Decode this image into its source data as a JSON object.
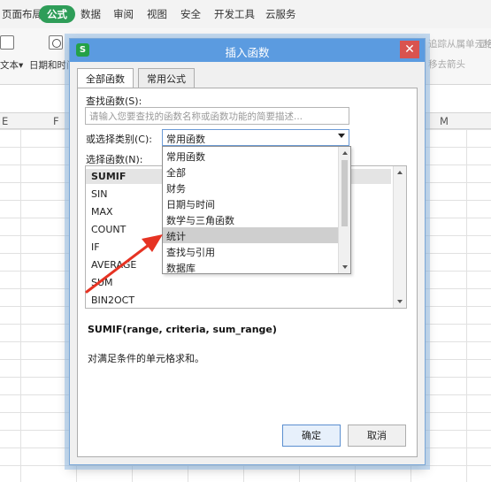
{
  "menubar": {
    "items": [
      "页面布局",
      "公式",
      "数据",
      "审阅",
      "视图",
      "安全",
      "开发工具",
      "云服务"
    ],
    "active": "公式"
  },
  "ribbon": {
    "left_text": "文本",
    "left_arrow": "▾",
    "datetime_label": "日期和时间",
    "datetime_arrow": "▾",
    "right_label_1": "追踪从属单元格",
    "right_label_2": "移去箭头",
    "right_label_3": "显示公式"
  },
  "columns": [
    "E",
    "F",
    "M"
  ],
  "dialog": {
    "title": "插入函数",
    "logo": "S",
    "close_glyph": "✕",
    "tabs": [
      "全部函数",
      "常用公式"
    ],
    "search_label": "查找函数(S):",
    "search_placeholder": "请输入您要查找的函数名称或函数功能的简要描述...",
    "category_label": "或选择类别(C):",
    "category_value": "常用函数",
    "function_label": "选择函数(N):",
    "functions": [
      "SUMIF",
      "SIN",
      "MAX",
      "COUNT",
      "IF",
      "AVERAGE",
      "SUM",
      "BIN2OCT"
    ],
    "selected_function": "SUMIF",
    "dropdown_options": [
      "常用函数",
      "全部",
      "财务",
      "日期与时间",
      "数学与三角函数",
      "统计",
      "查找与引用",
      "数据库"
    ],
    "highlighted_option": "统计",
    "signature": "SUMIF(range, criteria, sum_range)",
    "description": "对满足条件的单元格求和。",
    "ok_label": "确定",
    "cancel_label": "取消"
  },
  "colors": {
    "accent": "#2e9d58",
    "titlebar": "#5b9be0",
    "close": "#d9534f",
    "arrow": "#e63323"
  }
}
